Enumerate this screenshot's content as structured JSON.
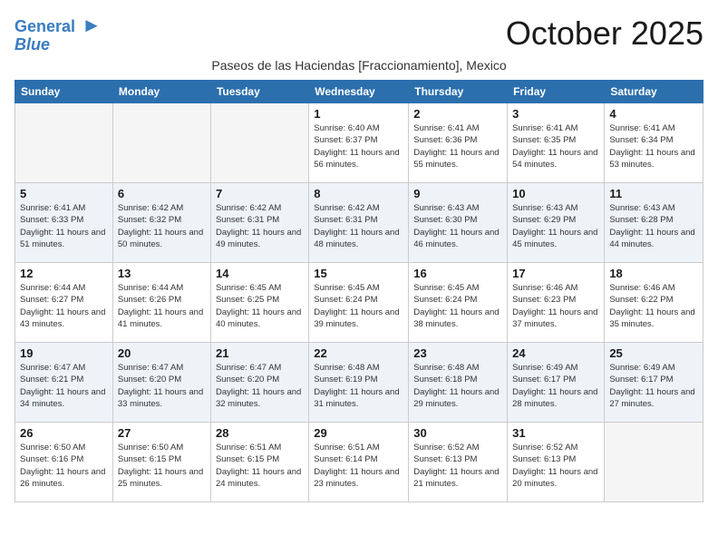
{
  "header": {
    "logo_line1": "General",
    "logo_line2": "Blue",
    "month_title": "October 2025",
    "subtitle": "Paseos de las Haciendas [Fraccionamiento], Mexico"
  },
  "weekdays": [
    "Sunday",
    "Monday",
    "Tuesday",
    "Wednesday",
    "Thursday",
    "Friday",
    "Saturday"
  ],
  "rows": [
    [
      {
        "day": "",
        "empty": true
      },
      {
        "day": "",
        "empty": true
      },
      {
        "day": "",
        "empty": true
      },
      {
        "day": "1",
        "sunrise": "6:40 AM",
        "sunset": "6:37 PM",
        "daylight": "11 hours and 56 minutes."
      },
      {
        "day": "2",
        "sunrise": "6:41 AM",
        "sunset": "6:36 PM",
        "daylight": "11 hours and 55 minutes."
      },
      {
        "day": "3",
        "sunrise": "6:41 AM",
        "sunset": "6:35 PM",
        "daylight": "11 hours and 54 minutes."
      },
      {
        "day": "4",
        "sunrise": "6:41 AM",
        "sunset": "6:34 PM",
        "daylight": "11 hours and 53 minutes."
      }
    ],
    [
      {
        "day": "5",
        "sunrise": "6:41 AM",
        "sunset": "6:33 PM",
        "daylight": "11 hours and 51 minutes."
      },
      {
        "day": "6",
        "sunrise": "6:42 AM",
        "sunset": "6:32 PM",
        "daylight": "11 hours and 50 minutes."
      },
      {
        "day": "7",
        "sunrise": "6:42 AM",
        "sunset": "6:31 PM",
        "daylight": "11 hours and 49 minutes."
      },
      {
        "day": "8",
        "sunrise": "6:42 AM",
        "sunset": "6:31 PM",
        "daylight": "11 hours and 48 minutes."
      },
      {
        "day": "9",
        "sunrise": "6:43 AM",
        "sunset": "6:30 PM",
        "daylight": "11 hours and 46 minutes."
      },
      {
        "day": "10",
        "sunrise": "6:43 AM",
        "sunset": "6:29 PM",
        "daylight": "11 hours and 45 minutes."
      },
      {
        "day": "11",
        "sunrise": "6:43 AM",
        "sunset": "6:28 PM",
        "daylight": "11 hours and 44 minutes."
      }
    ],
    [
      {
        "day": "12",
        "sunrise": "6:44 AM",
        "sunset": "6:27 PM",
        "daylight": "11 hours and 43 minutes."
      },
      {
        "day": "13",
        "sunrise": "6:44 AM",
        "sunset": "6:26 PM",
        "daylight": "11 hours and 41 minutes."
      },
      {
        "day": "14",
        "sunrise": "6:45 AM",
        "sunset": "6:25 PM",
        "daylight": "11 hours and 40 minutes."
      },
      {
        "day": "15",
        "sunrise": "6:45 AM",
        "sunset": "6:24 PM",
        "daylight": "11 hours and 39 minutes."
      },
      {
        "day": "16",
        "sunrise": "6:45 AM",
        "sunset": "6:24 PM",
        "daylight": "11 hours and 38 minutes."
      },
      {
        "day": "17",
        "sunrise": "6:46 AM",
        "sunset": "6:23 PM",
        "daylight": "11 hours and 37 minutes."
      },
      {
        "day": "18",
        "sunrise": "6:46 AM",
        "sunset": "6:22 PM",
        "daylight": "11 hours and 35 minutes."
      }
    ],
    [
      {
        "day": "19",
        "sunrise": "6:47 AM",
        "sunset": "6:21 PM",
        "daylight": "11 hours and 34 minutes."
      },
      {
        "day": "20",
        "sunrise": "6:47 AM",
        "sunset": "6:20 PM",
        "daylight": "11 hours and 33 minutes."
      },
      {
        "day": "21",
        "sunrise": "6:47 AM",
        "sunset": "6:20 PM",
        "daylight": "11 hours and 32 minutes."
      },
      {
        "day": "22",
        "sunrise": "6:48 AM",
        "sunset": "6:19 PM",
        "daylight": "11 hours and 31 minutes."
      },
      {
        "day": "23",
        "sunrise": "6:48 AM",
        "sunset": "6:18 PM",
        "daylight": "11 hours and 29 minutes."
      },
      {
        "day": "24",
        "sunrise": "6:49 AM",
        "sunset": "6:17 PM",
        "daylight": "11 hours and 28 minutes."
      },
      {
        "day": "25",
        "sunrise": "6:49 AM",
        "sunset": "6:17 PM",
        "daylight": "11 hours and 27 minutes."
      }
    ],
    [
      {
        "day": "26",
        "sunrise": "6:50 AM",
        "sunset": "6:16 PM",
        "daylight": "11 hours and 26 minutes."
      },
      {
        "day": "27",
        "sunrise": "6:50 AM",
        "sunset": "6:15 PM",
        "daylight": "11 hours and 25 minutes."
      },
      {
        "day": "28",
        "sunrise": "6:51 AM",
        "sunset": "6:15 PM",
        "daylight": "11 hours and 24 minutes."
      },
      {
        "day": "29",
        "sunrise": "6:51 AM",
        "sunset": "6:14 PM",
        "daylight": "11 hours and 23 minutes."
      },
      {
        "day": "30",
        "sunrise": "6:52 AM",
        "sunset": "6:13 PM",
        "daylight": "11 hours and 21 minutes."
      },
      {
        "day": "31",
        "sunrise": "6:52 AM",
        "sunset": "6:13 PM",
        "daylight": "11 hours and 20 minutes."
      },
      {
        "day": "",
        "empty": true
      }
    ]
  ]
}
